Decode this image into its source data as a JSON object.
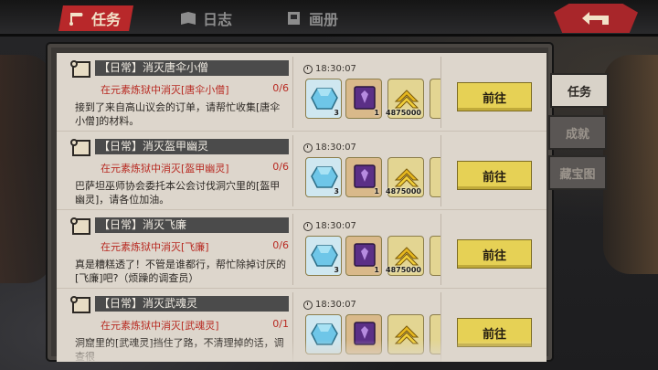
{
  "top_tabs": [
    {
      "label": "任务",
      "icon": "scroll-icon",
      "active": true
    },
    {
      "label": "日志",
      "icon": "book-icon",
      "active": false
    },
    {
      "label": "画册",
      "icon": "album-icon",
      "active": false
    }
  ],
  "back_button": {
    "icon": "back-arrow-icon"
  },
  "side_tabs": [
    {
      "label": "任务",
      "active": true
    },
    {
      "label": "成就",
      "active": false
    },
    {
      "label": "藏宝图",
      "active": false
    }
  ],
  "quests": [
    {
      "title": "【日常】消灭唐伞小僧",
      "target": "在元素炼狱中消灭[唐伞小僧]",
      "progress": "0/6",
      "desc": "接到了来自高山议会的订单，请帮忙收集[唐伞小僧]的材料。",
      "time": "18:30:07",
      "rewards": [
        {
          "icon": "crystal-icon",
          "count": "3"
        },
        {
          "icon": "spellbook-icon",
          "count": "1"
        },
        {
          "icon": "gold-chevron-icon",
          "count": "4875000"
        },
        {
          "icon": "reward-partial-icon",
          "count": ""
        }
      ],
      "button": "前往"
    },
    {
      "title": "【日常】消灭盔甲幽灵",
      "target": "在元素炼狱中消灭[盔甲幽灵]",
      "progress": "0/6",
      "desc": "巴萨坦巫师协会委托本公会讨伐洞穴里的[盔甲幽灵]，请各位加油。",
      "time": "18:30:07",
      "rewards": [
        {
          "icon": "crystal-icon",
          "count": "3"
        },
        {
          "icon": "spellbook-icon",
          "count": "1"
        },
        {
          "icon": "gold-chevron-icon",
          "count": "4875000"
        },
        {
          "icon": "reward-partial-icon",
          "count": ""
        }
      ],
      "button": "前往"
    },
    {
      "title": "【日常】消灭飞廉",
      "target": "在元素炼狱中消灭[飞廉]",
      "progress": "0/6",
      "desc": "真是糟糕透了！不管是谁都行，帮忙除掉讨厌的[飞廉]吧?（烦躁的调查员）",
      "time": "18:30:07",
      "rewards": [
        {
          "icon": "crystal-icon",
          "count": "3"
        },
        {
          "icon": "spellbook-icon",
          "count": "1"
        },
        {
          "icon": "gold-chevron-icon",
          "count": "4875000"
        },
        {
          "icon": "reward-partial-icon",
          "count": ""
        }
      ],
      "button": "前往"
    },
    {
      "title": "【日常】消灭武魂灵",
      "target": "在元素炼狱中消灭[武魂灵]",
      "progress": "0/1",
      "desc": "洞窟里的[武魂灵]挡住了路，不清理掉的话，调查很",
      "time": "18:30:07",
      "rewards": [
        {
          "icon": "crystal-icon",
          "count": ""
        },
        {
          "icon": "spellbook-icon",
          "count": ""
        },
        {
          "icon": "gold-chevron-icon",
          "count": ""
        },
        {
          "icon": "reward-partial-icon",
          "count": ""
        }
      ],
      "button": "前往"
    }
  ],
  "colors": {
    "accent_red": "#b8282a",
    "button_yellow": "#e6d155",
    "panel_bg": "#ddd6cc",
    "target_red": "#b82a22"
  }
}
